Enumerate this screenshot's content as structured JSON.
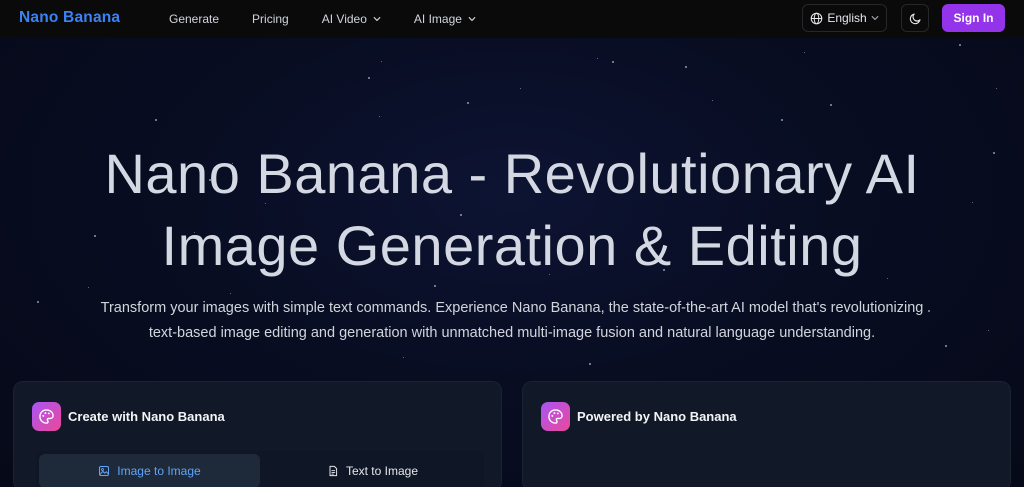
{
  "nav": {
    "brand": "Nano Banana",
    "links": [
      {
        "label": "Generate"
      },
      {
        "label": "Pricing"
      },
      {
        "label": "AI Video",
        "has_dropdown": true
      },
      {
        "label": "AI Image",
        "has_dropdown": true
      }
    ],
    "language": "English",
    "theme_icon": "moon-icon",
    "signin_label": "Sign In"
  },
  "hero": {
    "title_line1": "Nano Banana - Revolutionary AI",
    "title_line2": "Image Generation & Editing",
    "subtitle_line1": "Transform your images with simple text commands. Experience Nano Banana, the state-of-the-art AI model that's revolutionizing",
    "subtitle_line2": "text-based image editing and generation with unmatched multi-image fusion and natural language understanding."
  },
  "cards": {
    "create": {
      "icon": "palette-icon",
      "title": "Create with Nano Banana",
      "tabs": [
        {
          "label": "Image to Image",
          "icon": "image-icon",
          "active": true
        },
        {
          "label": "Text to Image",
          "icon": "document-icon",
          "active": false
        }
      ]
    },
    "powered": {
      "icon": "palette-icon",
      "title": "Powered by Nano Banana"
    }
  },
  "colors": {
    "brand": "#3b82f6",
    "signin_bg": "#9333ea",
    "active_tab_text": "#60a5fa",
    "icon_gradient_start": "#a855f7",
    "icon_gradient_end": "#ec4899"
  }
}
